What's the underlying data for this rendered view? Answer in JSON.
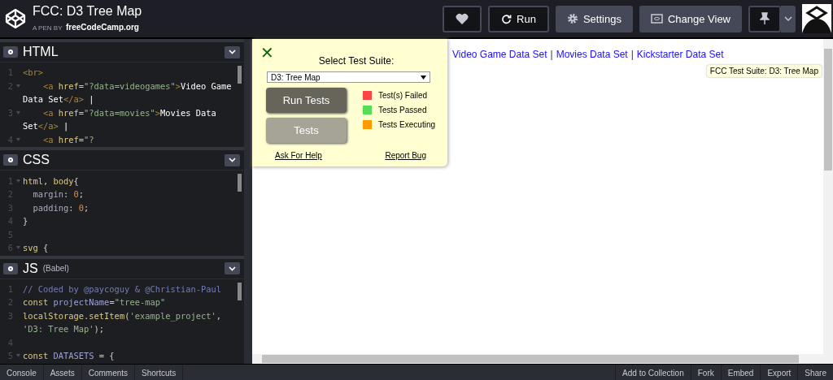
{
  "header": {
    "title": "FCC: D3 Tree Map",
    "byline_prefix": "A PEN BY",
    "author": "freeCodeCamp.org",
    "buttons": [
      {
        "kind": "heart"
      },
      {
        "kind": "run",
        "label": "Run"
      },
      {
        "kind": "settings",
        "label": "Settings"
      },
      {
        "kind": "view",
        "label": "Change View"
      },
      {
        "kind": "pin"
      }
    ]
  },
  "editors": [
    {
      "title": "HTML",
      "rows": [
        {
          "number": "1",
          "fold": false,
          "tokens": [
            {
              "kind": "tag",
              "text": "<br>"
            }
          ]
        },
        {
          "number": "2",
          "fold": true,
          "tokens": [
            {
              "kind": "tag",
              "text": "    <a "
            },
            {
              "kind": "attr",
              "text": "href"
            },
            {
              "kind": "punct",
              "text": "="
            },
            {
              "kind": "string",
              "text": "\"?data=videogames\""
            },
            {
              "kind": "tag",
              "text": ">"
            },
            {
              "kind": "text",
              "text": "Video Game"
            }
          ]
        },
        {
          "number": "",
          "fold": false,
          "tokens": [
            {
              "kind": "text",
              "text": "Data Set"
            },
            {
              "kind": "tag",
              "text": "</a>"
            },
            {
              "kind": "text",
              "text": " |"
            }
          ]
        },
        {
          "number": "3",
          "fold": true,
          "tokens": [
            {
              "kind": "tag",
              "text": "    <a "
            },
            {
              "kind": "attr",
              "text": "href"
            },
            {
              "kind": "punct",
              "text": "="
            },
            {
              "kind": "string",
              "text": "\"?data=movies\""
            },
            {
              "kind": "tag",
              "text": ">"
            },
            {
              "kind": "text",
              "text": "Movies Data"
            }
          ]
        },
        {
          "number": "",
          "fold": false,
          "tokens": [
            {
              "kind": "text",
              "text": "Set"
            },
            {
              "kind": "tag",
              "text": "</a>"
            },
            {
              "kind": "text",
              "text": " |"
            }
          ]
        },
        {
          "number": "4",
          "fold": true,
          "tokens": [
            {
              "kind": "tag",
              "text": "    <a "
            },
            {
              "kind": "attr",
              "text": "href"
            },
            {
              "kind": "punct",
              "text": "="
            },
            {
              "kind": "string",
              "text": "\"?"
            }
          ]
        }
      ]
    },
    {
      "title": "CSS",
      "rows": [
        {
          "number": "1",
          "fold": true,
          "tokens": [
            {
              "kind": "keyword",
              "text": "html, body"
            },
            {
              "kind": "punct",
              "text": "{"
            }
          ]
        },
        {
          "number": "2",
          "fold": false,
          "tokens": [
            {
              "kind": "prop",
              "text": "  margin"
            },
            {
              "kind": "punct",
              "text": ": "
            },
            {
              "kind": "number",
              "text": "0"
            },
            {
              "kind": "punct",
              "text": ";"
            }
          ]
        },
        {
          "number": "3",
          "fold": false,
          "tokens": [
            {
              "kind": "prop",
              "text": "  padding"
            },
            {
              "kind": "punct",
              "text": ": "
            },
            {
              "kind": "number",
              "text": "0"
            },
            {
              "kind": "punct",
              "text": ";"
            }
          ]
        },
        {
          "number": "4",
          "fold": false,
          "tokens": [
            {
              "kind": "punct",
              "text": "}"
            }
          ]
        },
        {
          "number": "5",
          "fold": false,
          "tokens": []
        },
        {
          "number": "6",
          "fold": true,
          "tokens": [
            {
              "kind": "keyword",
              "text": "svg"
            },
            {
              "kind": "punct",
              "text": " {"
            }
          ]
        }
      ]
    },
    {
      "title": "JS",
      "subtitle": "(Babel)",
      "rows": [
        {
          "number": "1",
          "fold": false,
          "tokens": [
            {
              "kind": "comment",
              "text": "// Coded by @paycoguy & @Christian-Paul"
            }
          ]
        },
        {
          "number": "2",
          "fold": false,
          "tokens": [
            {
              "kind": "keyword",
              "text": "const "
            },
            {
              "kind": "variable",
              "text": "projectName"
            },
            {
              "kind": "punct",
              "text": "="
            },
            {
              "kind": "string",
              "text": "\"tree-map\""
            }
          ]
        },
        {
          "number": "3",
          "fold": false,
          "tokens": [
            {
              "kind": "keyword",
              "text": "localStorage"
            },
            {
              "kind": "punct",
              "text": "."
            },
            {
              "kind": "keyword",
              "text": "setItem"
            },
            {
              "kind": "punct",
              "text": "("
            },
            {
              "kind": "string",
              "text": "'example_project'"
            },
            {
              "kind": "punct",
              "text": ","
            }
          ]
        },
        {
          "number": "",
          "fold": false,
          "tokens": [
            {
              "kind": "string",
              "text": "'D3: Tree Map'"
            },
            {
              "kind": "punct",
              "text": ");"
            }
          ]
        },
        {
          "number": "4",
          "fold": false,
          "tokens": []
        },
        {
          "number": "5",
          "fold": true,
          "tokens": [
            {
              "kind": "keyword",
              "text": "const "
            },
            {
              "kind": "variable",
              "text": "DATASETS"
            },
            {
              "kind": "punct",
              "text": " = {"
            }
          ]
        }
      ]
    }
  ],
  "preview": {
    "links": [
      "Video Game Data Set",
      "Movies Data Set",
      "Kickstarter Data Set"
    ],
    "separator": "|",
    "tooltip": "FCC Test Suite: D3: Tree Map",
    "test_panel": {
      "close": "✕",
      "heading": "Select Test Suite:",
      "suite": "D3: Tree Map",
      "run_button": "Run Tests",
      "tests_button": "Tests",
      "legend": [
        {
          "label": "Test(s) Failed",
          "color": "#ff4444"
        },
        {
          "label": "Tests Passed",
          "color": "#55dd55"
        },
        {
          "label": "Tests Executing",
          "color": "#ff9900"
        }
      ],
      "help_link": "Ask For Help",
      "bug_link": "Report Bug"
    }
  },
  "footer": {
    "left": [
      "Console",
      "Assets",
      "Comments",
      "Shortcuts"
    ],
    "right": [
      "Add to Collection",
      "Fork",
      "Embed",
      "Export",
      "Share"
    ]
  }
}
